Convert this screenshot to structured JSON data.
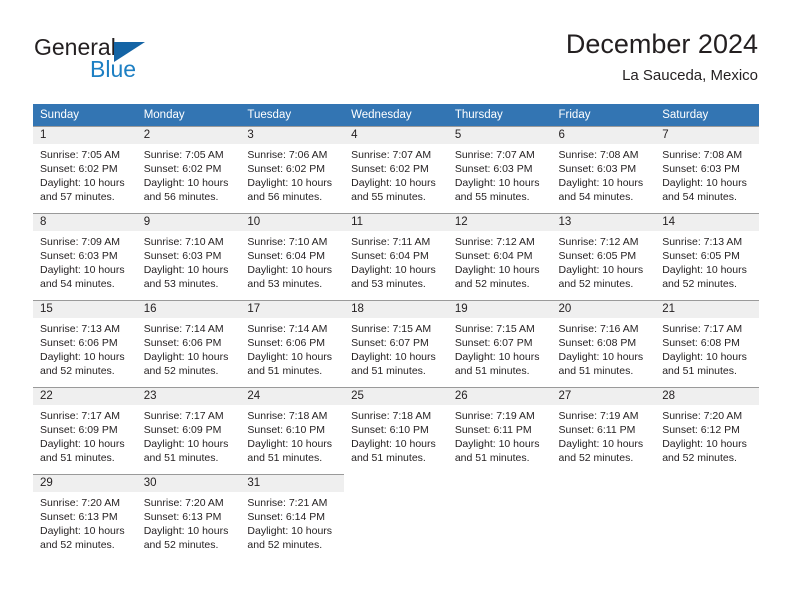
{
  "brand": {
    "name_top": "General",
    "name_bottom": "Blue",
    "triangle_color": "#1464a5",
    "blue_color": "#1d7fc3"
  },
  "header": {
    "title": "December 2024",
    "subtitle": "La Sauceda, Mexico"
  },
  "theme": {
    "header_bg": "#3375b3",
    "daynum_bg": "#efefef",
    "rule_color": "#9a9a9a",
    "text_color": "#231f20"
  },
  "calendar": {
    "weekday_headers": [
      "Sunday",
      "Monday",
      "Tuesday",
      "Wednesday",
      "Thursday",
      "Friday",
      "Saturday"
    ],
    "labels": {
      "sunrise": "Sunrise:",
      "sunset": "Sunset:",
      "daylight": "Daylight:"
    },
    "weeks": [
      [
        {
          "day": "1",
          "sunrise": "Sunrise: 7:05 AM",
          "sunset": "Sunset: 6:02 PM",
          "daylight_line1": "Daylight: 10 hours",
          "daylight_line2": "and 57 minutes."
        },
        {
          "day": "2",
          "sunrise": "Sunrise: 7:05 AM",
          "sunset": "Sunset: 6:02 PM",
          "daylight_line1": "Daylight: 10 hours",
          "daylight_line2": "and 56 minutes."
        },
        {
          "day": "3",
          "sunrise": "Sunrise: 7:06 AM",
          "sunset": "Sunset: 6:02 PM",
          "daylight_line1": "Daylight: 10 hours",
          "daylight_line2": "and 56 minutes."
        },
        {
          "day": "4",
          "sunrise": "Sunrise: 7:07 AM",
          "sunset": "Sunset: 6:02 PM",
          "daylight_line1": "Daylight: 10 hours",
          "daylight_line2": "and 55 minutes."
        },
        {
          "day": "5",
          "sunrise": "Sunrise: 7:07 AM",
          "sunset": "Sunset: 6:03 PM",
          "daylight_line1": "Daylight: 10 hours",
          "daylight_line2": "and 55 minutes."
        },
        {
          "day": "6",
          "sunrise": "Sunrise: 7:08 AM",
          "sunset": "Sunset: 6:03 PM",
          "daylight_line1": "Daylight: 10 hours",
          "daylight_line2": "and 54 minutes."
        },
        {
          "day": "7",
          "sunrise": "Sunrise: 7:08 AM",
          "sunset": "Sunset: 6:03 PM",
          "daylight_line1": "Daylight: 10 hours",
          "daylight_line2": "and 54 minutes."
        }
      ],
      [
        {
          "day": "8",
          "sunrise": "Sunrise: 7:09 AM",
          "sunset": "Sunset: 6:03 PM",
          "daylight_line1": "Daylight: 10 hours",
          "daylight_line2": "and 54 minutes."
        },
        {
          "day": "9",
          "sunrise": "Sunrise: 7:10 AM",
          "sunset": "Sunset: 6:03 PM",
          "daylight_line1": "Daylight: 10 hours",
          "daylight_line2": "and 53 minutes."
        },
        {
          "day": "10",
          "sunrise": "Sunrise: 7:10 AM",
          "sunset": "Sunset: 6:04 PM",
          "daylight_line1": "Daylight: 10 hours",
          "daylight_line2": "and 53 minutes."
        },
        {
          "day": "11",
          "sunrise": "Sunrise: 7:11 AM",
          "sunset": "Sunset: 6:04 PM",
          "daylight_line1": "Daylight: 10 hours",
          "daylight_line2": "and 53 minutes."
        },
        {
          "day": "12",
          "sunrise": "Sunrise: 7:12 AM",
          "sunset": "Sunset: 6:04 PM",
          "daylight_line1": "Daylight: 10 hours",
          "daylight_line2": "and 52 minutes."
        },
        {
          "day": "13",
          "sunrise": "Sunrise: 7:12 AM",
          "sunset": "Sunset: 6:05 PM",
          "daylight_line1": "Daylight: 10 hours",
          "daylight_line2": "and 52 minutes."
        },
        {
          "day": "14",
          "sunrise": "Sunrise: 7:13 AM",
          "sunset": "Sunset: 6:05 PM",
          "daylight_line1": "Daylight: 10 hours",
          "daylight_line2": "and 52 minutes."
        }
      ],
      [
        {
          "day": "15",
          "sunrise": "Sunrise: 7:13 AM",
          "sunset": "Sunset: 6:06 PM",
          "daylight_line1": "Daylight: 10 hours",
          "daylight_line2": "and 52 minutes."
        },
        {
          "day": "16",
          "sunrise": "Sunrise: 7:14 AM",
          "sunset": "Sunset: 6:06 PM",
          "daylight_line1": "Daylight: 10 hours",
          "daylight_line2": "and 52 minutes."
        },
        {
          "day": "17",
          "sunrise": "Sunrise: 7:14 AM",
          "sunset": "Sunset: 6:06 PM",
          "daylight_line1": "Daylight: 10 hours",
          "daylight_line2": "and 51 minutes."
        },
        {
          "day": "18",
          "sunrise": "Sunrise: 7:15 AM",
          "sunset": "Sunset: 6:07 PM",
          "daylight_line1": "Daylight: 10 hours",
          "daylight_line2": "and 51 minutes."
        },
        {
          "day": "19",
          "sunrise": "Sunrise: 7:15 AM",
          "sunset": "Sunset: 6:07 PM",
          "daylight_line1": "Daylight: 10 hours",
          "daylight_line2": "and 51 minutes."
        },
        {
          "day": "20",
          "sunrise": "Sunrise: 7:16 AM",
          "sunset": "Sunset: 6:08 PM",
          "daylight_line1": "Daylight: 10 hours",
          "daylight_line2": "and 51 minutes."
        },
        {
          "day": "21",
          "sunrise": "Sunrise: 7:17 AM",
          "sunset": "Sunset: 6:08 PM",
          "daylight_line1": "Daylight: 10 hours",
          "daylight_line2": "and 51 minutes."
        }
      ],
      [
        {
          "day": "22",
          "sunrise": "Sunrise: 7:17 AM",
          "sunset": "Sunset: 6:09 PM",
          "daylight_line1": "Daylight: 10 hours",
          "daylight_line2": "and 51 minutes."
        },
        {
          "day": "23",
          "sunrise": "Sunrise: 7:17 AM",
          "sunset": "Sunset: 6:09 PM",
          "daylight_line1": "Daylight: 10 hours",
          "daylight_line2": "and 51 minutes."
        },
        {
          "day": "24",
          "sunrise": "Sunrise: 7:18 AM",
          "sunset": "Sunset: 6:10 PM",
          "daylight_line1": "Daylight: 10 hours",
          "daylight_line2": "and 51 minutes."
        },
        {
          "day": "25",
          "sunrise": "Sunrise: 7:18 AM",
          "sunset": "Sunset: 6:10 PM",
          "daylight_line1": "Daylight: 10 hours",
          "daylight_line2": "and 51 minutes."
        },
        {
          "day": "26",
          "sunrise": "Sunrise: 7:19 AM",
          "sunset": "Sunset: 6:11 PM",
          "daylight_line1": "Daylight: 10 hours",
          "daylight_line2": "and 51 minutes."
        },
        {
          "day": "27",
          "sunrise": "Sunrise: 7:19 AM",
          "sunset": "Sunset: 6:11 PM",
          "daylight_line1": "Daylight: 10 hours",
          "daylight_line2": "and 52 minutes."
        },
        {
          "day": "28",
          "sunrise": "Sunrise: 7:20 AM",
          "sunset": "Sunset: 6:12 PM",
          "daylight_line1": "Daylight: 10 hours",
          "daylight_line2": "and 52 minutes."
        }
      ],
      [
        {
          "day": "29",
          "sunrise": "Sunrise: 7:20 AM",
          "sunset": "Sunset: 6:13 PM",
          "daylight_line1": "Daylight: 10 hours",
          "daylight_line2": "and 52 minutes."
        },
        {
          "day": "30",
          "sunrise": "Sunrise: 7:20 AM",
          "sunset": "Sunset: 6:13 PM",
          "daylight_line1": "Daylight: 10 hours",
          "daylight_line2": "and 52 minutes."
        },
        {
          "day": "31",
          "sunrise": "Sunrise: 7:21 AM",
          "sunset": "Sunset: 6:14 PM",
          "daylight_line1": "Daylight: 10 hours",
          "daylight_line2": "and 52 minutes."
        },
        {
          "day": "",
          "sunrise": "",
          "sunset": "",
          "daylight_line1": "",
          "daylight_line2": ""
        },
        {
          "day": "",
          "sunrise": "",
          "sunset": "",
          "daylight_line1": "",
          "daylight_line2": ""
        },
        {
          "day": "",
          "sunrise": "",
          "sunset": "",
          "daylight_line1": "",
          "daylight_line2": ""
        },
        {
          "day": "",
          "sunrise": "",
          "sunset": "",
          "daylight_line1": "",
          "daylight_line2": ""
        }
      ]
    ]
  }
}
